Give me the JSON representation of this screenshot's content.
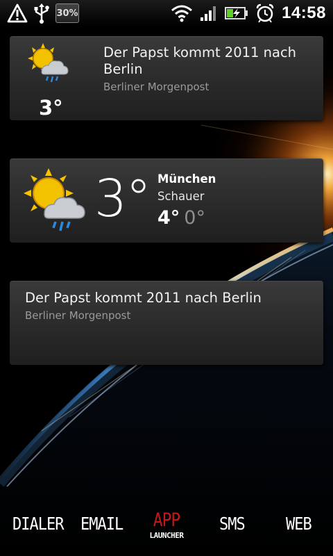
{
  "status_bar": {
    "battery_percent": "30%",
    "time": "14:58",
    "icons": [
      "warning-icon",
      "usb-icon",
      "battery-percent-box",
      "wifi-icon",
      "signal-icon",
      "battery-charging-icon",
      "alarm-clock-icon"
    ]
  },
  "news_widget_1": {
    "weather_icon": "sun-cloud-rain-icon",
    "temperature": "3°",
    "headline": "Der Papst kommt 2011 nach Berlin",
    "source": "Berliner Morgenpost"
  },
  "weather_widget": {
    "icon": "sun-cloud-rain-icon",
    "temperature": "3°",
    "city": "München",
    "condition": "Schauer",
    "high": "4°",
    "low": "0°"
  },
  "news_widget_2": {
    "headline": "Der Papst kommt 2011 nach Berlin",
    "source": "Berliner Morgenpost"
  },
  "dock": {
    "dialer": "DIALER",
    "email": "EMAIL",
    "app_launcher_main": "APP",
    "app_launcher_sub": "LAUNCHER",
    "sms": "SMS",
    "web": "WEB"
  },
  "colors": {
    "app_launcher_accent": "#c0191b",
    "card_background": "#2e2e2e",
    "secondary_text": "#9a9a9a"
  }
}
